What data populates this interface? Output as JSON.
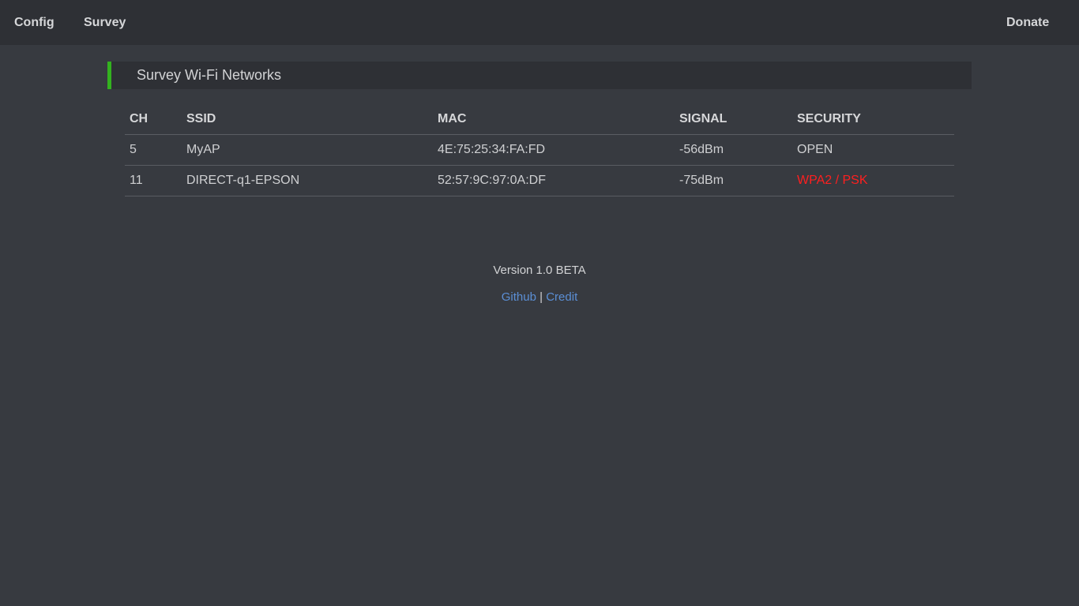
{
  "nav": {
    "config_label": "Config",
    "survey_label": "Survey",
    "donate_label": "Donate"
  },
  "section": {
    "title": "Survey Wi-Fi Networks",
    "accent_color": "#33b21f"
  },
  "table": {
    "headers": [
      "CH",
      "SSID",
      "MAC",
      "SIGNAL",
      "SECURITY"
    ],
    "rows": [
      {
        "ch": "5",
        "ssid": "MyAP",
        "mac": "4E:75:25:34:FA:FD",
        "signal": "-56dBm",
        "security": "OPEN",
        "security_color": "#cfd0d2"
      },
      {
        "ch": "11",
        "ssid": "DIRECT-q1-EPSON",
        "mac": "52:57:9C:97:0A:DF",
        "signal": "-75dBm",
        "security": "WPA2 / PSK",
        "security_color": "#ff1f1f"
      }
    ]
  },
  "footer": {
    "version": "Version 1.0 BETA",
    "github_label": "Github",
    "separator": "|",
    "credit_label": "Credit",
    "link_color": "#5b8fd6"
  }
}
